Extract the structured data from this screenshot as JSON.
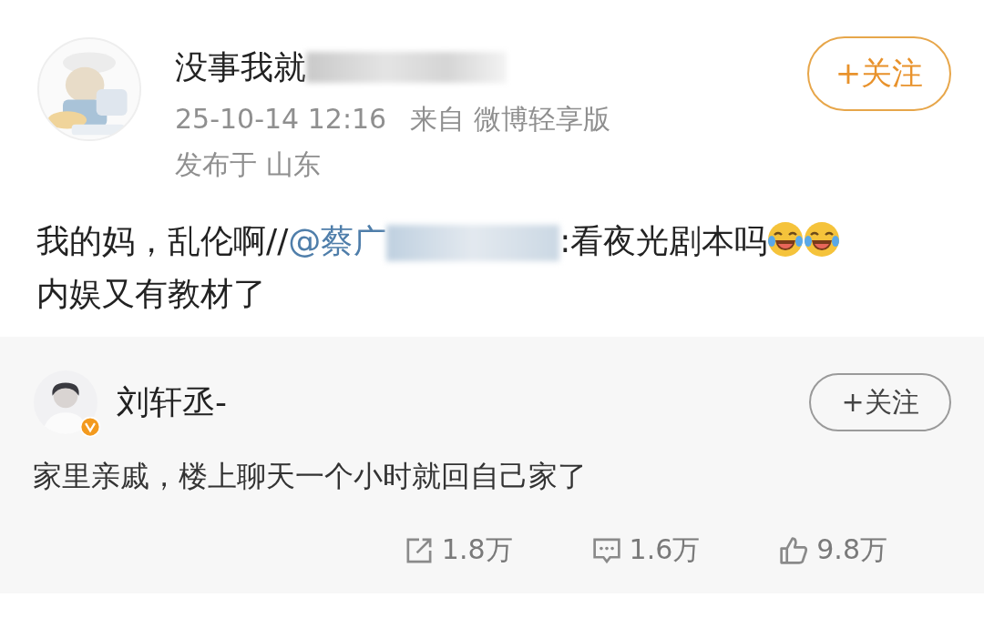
{
  "post": {
    "author": {
      "name": "没事我就",
      "redacted": true
    },
    "follow_button": {
      "label": "+关注"
    },
    "time": "25-10-14 12:16",
    "source": "来自 微博轻享版",
    "location": "发布于 山东",
    "content": [
      {
        "kind": "text",
        "text": "我的妈，乱伦啊//"
      },
      {
        "kind": "mention",
        "text": "@蔡广"
      },
      {
        "kind": "redaction"
      },
      {
        "kind": "text",
        "text": ":看夜光剧本吗"
      },
      {
        "kind": "emoji"
      },
      {
        "kind": "emoji"
      },
      {
        "kind": "text",
        "text": "内娱又有教材了"
      }
    ]
  },
  "repost": {
    "author": {
      "name": "刘轩丞-",
      "verified": true
    },
    "follow_button": {
      "label": "+关注"
    },
    "text": "家里亲戚，楼上聊天一个小时就回自己家了",
    "stats": [
      {
        "kind": "share",
        "count": "1.8万"
      },
      {
        "kind": "comment",
        "count": "1.6万"
      },
      {
        "kind": "like",
        "count": "9.8万"
      }
    ]
  }
}
